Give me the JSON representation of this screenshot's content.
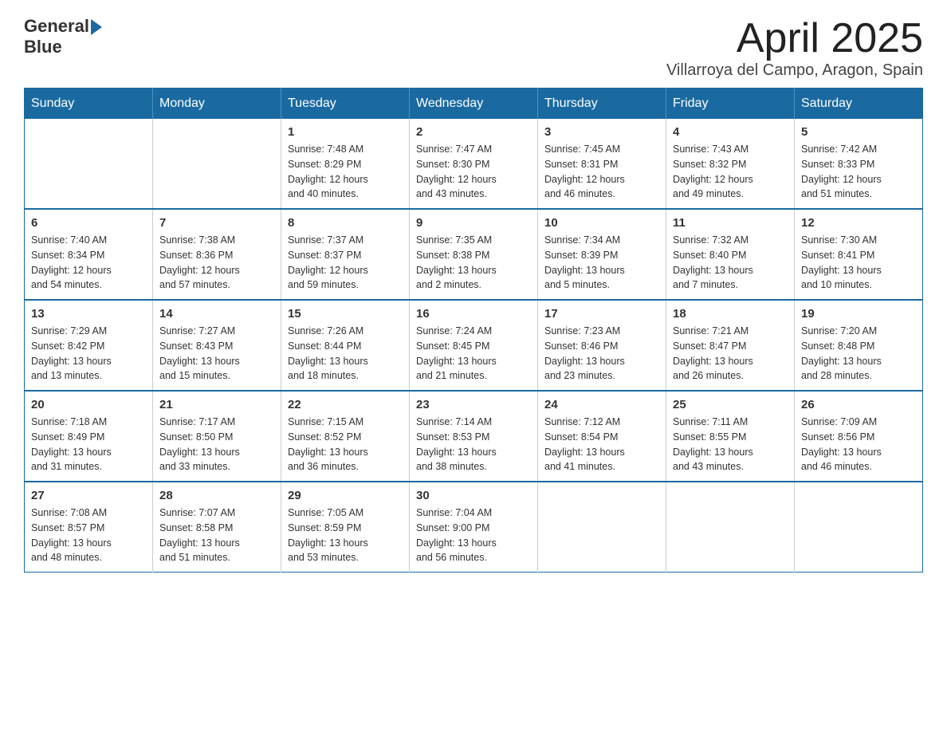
{
  "header": {
    "logo_text_general": "General",
    "logo_text_blue": "Blue",
    "title": "April 2025",
    "subtitle": "Villarroya del Campo, Aragon, Spain"
  },
  "days_of_week": [
    "Sunday",
    "Monday",
    "Tuesday",
    "Wednesday",
    "Thursday",
    "Friday",
    "Saturday"
  ],
  "weeks": [
    [
      {
        "day": "",
        "info": ""
      },
      {
        "day": "",
        "info": ""
      },
      {
        "day": "1",
        "info": "Sunrise: 7:48 AM\nSunset: 8:29 PM\nDaylight: 12 hours\nand 40 minutes."
      },
      {
        "day": "2",
        "info": "Sunrise: 7:47 AM\nSunset: 8:30 PM\nDaylight: 12 hours\nand 43 minutes."
      },
      {
        "day": "3",
        "info": "Sunrise: 7:45 AM\nSunset: 8:31 PM\nDaylight: 12 hours\nand 46 minutes."
      },
      {
        "day": "4",
        "info": "Sunrise: 7:43 AM\nSunset: 8:32 PM\nDaylight: 12 hours\nand 49 minutes."
      },
      {
        "day": "5",
        "info": "Sunrise: 7:42 AM\nSunset: 8:33 PM\nDaylight: 12 hours\nand 51 minutes."
      }
    ],
    [
      {
        "day": "6",
        "info": "Sunrise: 7:40 AM\nSunset: 8:34 PM\nDaylight: 12 hours\nand 54 minutes."
      },
      {
        "day": "7",
        "info": "Sunrise: 7:38 AM\nSunset: 8:36 PM\nDaylight: 12 hours\nand 57 minutes."
      },
      {
        "day": "8",
        "info": "Sunrise: 7:37 AM\nSunset: 8:37 PM\nDaylight: 12 hours\nand 59 minutes."
      },
      {
        "day": "9",
        "info": "Sunrise: 7:35 AM\nSunset: 8:38 PM\nDaylight: 13 hours\nand 2 minutes."
      },
      {
        "day": "10",
        "info": "Sunrise: 7:34 AM\nSunset: 8:39 PM\nDaylight: 13 hours\nand 5 minutes."
      },
      {
        "day": "11",
        "info": "Sunrise: 7:32 AM\nSunset: 8:40 PM\nDaylight: 13 hours\nand 7 minutes."
      },
      {
        "day": "12",
        "info": "Sunrise: 7:30 AM\nSunset: 8:41 PM\nDaylight: 13 hours\nand 10 minutes."
      }
    ],
    [
      {
        "day": "13",
        "info": "Sunrise: 7:29 AM\nSunset: 8:42 PM\nDaylight: 13 hours\nand 13 minutes."
      },
      {
        "day": "14",
        "info": "Sunrise: 7:27 AM\nSunset: 8:43 PM\nDaylight: 13 hours\nand 15 minutes."
      },
      {
        "day": "15",
        "info": "Sunrise: 7:26 AM\nSunset: 8:44 PM\nDaylight: 13 hours\nand 18 minutes."
      },
      {
        "day": "16",
        "info": "Sunrise: 7:24 AM\nSunset: 8:45 PM\nDaylight: 13 hours\nand 21 minutes."
      },
      {
        "day": "17",
        "info": "Sunrise: 7:23 AM\nSunset: 8:46 PM\nDaylight: 13 hours\nand 23 minutes."
      },
      {
        "day": "18",
        "info": "Sunrise: 7:21 AM\nSunset: 8:47 PM\nDaylight: 13 hours\nand 26 minutes."
      },
      {
        "day": "19",
        "info": "Sunrise: 7:20 AM\nSunset: 8:48 PM\nDaylight: 13 hours\nand 28 minutes."
      }
    ],
    [
      {
        "day": "20",
        "info": "Sunrise: 7:18 AM\nSunset: 8:49 PM\nDaylight: 13 hours\nand 31 minutes."
      },
      {
        "day": "21",
        "info": "Sunrise: 7:17 AM\nSunset: 8:50 PM\nDaylight: 13 hours\nand 33 minutes."
      },
      {
        "day": "22",
        "info": "Sunrise: 7:15 AM\nSunset: 8:52 PM\nDaylight: 13 hours\nand 36 minutes."
      },
      {
        "day": "23",
        "info": "Sunrise: 7:14 AM\nSunset: 8:53 PM\nDaylight: 13 hours\nand 38 minutes."
      },
      {
        "day": "24",
        "info": "Sunrise: 7:12 AM\nSunset: 8:54 PM\nDaylight: 13 hours\nand 41 minutes."
      },
      {
        "day": "25",
        "info": "Sunrise: 7:11 AM\nSunset: 8:55 PM\nDaylight: 13 hours\nand 43 minutes."
      },
      {
        "day": "26",
        "info": "Sunrise: 7:09 AM\nSunset: 8:56 PM\nDaylight: 13 hours\nand 46 minutes."
      }
    ],
    [
      {
        "day": "27",
        "info": "Sunrise: 7:08 AM\nSunset: 8:57 PM\nDaylight: 13 hours\nand 48 minutes."
      },
      {
        "day": "28",
        "info": "Sunrise: 7:07 AM\nSunset: 8:58 PM\nDaylight: 13 hours\nand 51 minutes."
      },
      {
        "day": "29",
        "info": "Sunrise: 7:05 AM\nSunset: 8:59 PM\nDaylight: 13 hours\nand 53 minutes."
      },
      {
        "day": "30",
        "info": "Sunrise: 7:04 AM\nSunset: 9:00 PM\nDaylight: 13 hours\nand 56 minutes."
      },
      {
        "day": "",
        "info": ""
      },
      {
        "day": "",
        "info": ""
      },
      {
        "day": "",
        "info": ""
      }
    ]
  ]
}
